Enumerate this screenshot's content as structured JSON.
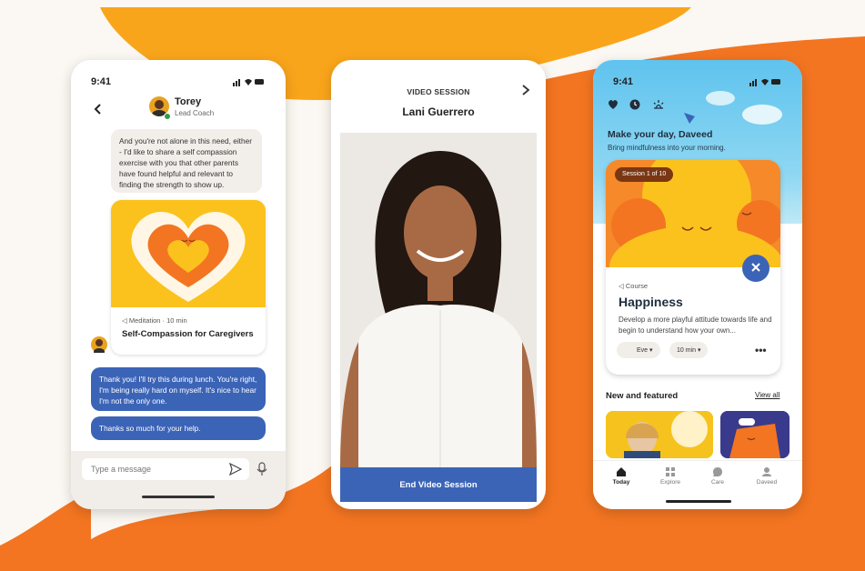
{
  "colors": {
    "orange": "#f37521",
    "yellow": "#f9a51b",
    "blue": "#3b64b7",
    "cream": "#fbf7f2"
  },
  "chat": {
    "time": "9:41",
    "coach_name": "Torey",
    "coach_role": "Lead Coach",
    "incoming": "And you're not alone in this need, either - I'd like to share a self compassion exercise with you that other parents have found helpful and relevant to finding the strength to show up.",
    "meditation_meta": "Meditation · 10 min",
    "meditation_title": "Self-Compassion for Caregivers",
    "outgoing_1": "Thank you! I'll try this during lunch. You're right, I'm being really hard on myself. It's nice to hear I'm not the only one.",
    "outgoing_2": "Thanks so much for your help.",
    "input_placeholder": "Type a message"
  },
  "video": {
    "label": "VIDEO SESSION",
    "person": "Lani Guerrero",
    "end_label": "End Video Session"
  },
  "today": {
    "time": "9:41",
    "greeting": "Make your day, Daveed",
    "greeting_sub": "Bring mindfulness into your morning.",
    "session_tag": "Session 1 of 10",
    "course_meta": "Course",
    "course_title": "Happiness",
    "course_desc": "Develop a more playful attitude towards life and begin to understand how your own...",
    "chip_user": "Eve",
    "chip_duration": "10 min",
    "more": "•••",
    "section_title": "New and featured",
    "view_all": "View all",
    "tabs": [
      {
        "label": "Today"
      },
      {
        "label": "Explore"
      },
      {
        "label": "Care"
      },
      {
        "label": "Daveed"
      }
    ]
  }
}
